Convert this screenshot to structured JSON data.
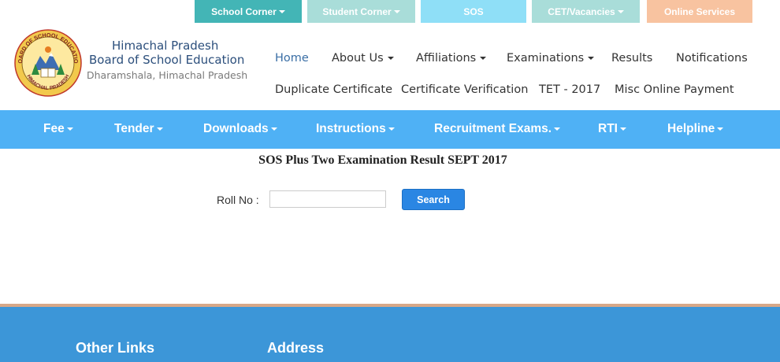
{
  "top_tabs": [
    {
      "label": "School Corner",
      "dropdown": true,
      "color": "#43b5b6"
    },
    {
      "label": "Student Corner",
      "dropdown": true,
      "color": "#a9ddd9"
    },
    {
      "label": "SOS",
      "dropdown": false,
      "color": "#8fdff7"
    },
    {
      "label": "CET/Vacancies",
      "dropdown": true,
      "color": "#a9ddd9"
    },
    {
      "label": "Online Services",
      "dropdown": false,
      "color": "#f8c3a0"
    }
  ],
  "brand": {
    "line1": "Himachal Pradesh",
    "line2": "Board of School Education",
    "line3": "Dharamshala, Himachal Pradesh",
    "logo_icon": "hpbose-emblem-icon",
    "logo_ring_text": "BOARD OF SCHOOL EDUCATION",
    "logo_bottom_text": "HIMACHAL PRADESH"
  },
  "main_nav": {
    "row1": [
      {
        "label": "Home",
        "active": true
      },
      {
        "label": "About Us",
        "dropdown": true
      },
      {
        "label": "Affiliations",
        "dropdown": true
      },
      {
        "label": "Examinations",
        "dropdown": true
      },
      {
        "label": "Results"
      },
      {
        "label": "Notifications"
      }
    ],
    "row2": [
      {
        "label": "Duplicate Certificate"
      },
      {
        "label": "Certificate Verification"
      },
      {
        "label": "TET - 2017"
      },
      {
        "label": "Misc Online Payment"
      }
    ]
  },
  "menu_bar": {
    "color": "#4fb1f5",
    "items": [
      {
        "label": "Fee"
      },
      {
        "label": "Tender"
      },
      {
        "label": "Downloads"
      },
      {
        "label": "Instructions"
      },
      {
        "label": "Recruitment Exams."
      },
      {
        "label": "RTI"
      },
      {
        "label": "Helpline"
      }
    ]
  },
  "content": {
    "title": "SOS Plus Two Examination Result SEPT 2017",
    "roll_label": "Roll No :",
    "roll_value": "",
    "search_label": "Search"
  },
  "footer": {
    "color": "#3c96d8",
    "headings": [
      "Other Links",
      "Address"
    ]
  }
}
